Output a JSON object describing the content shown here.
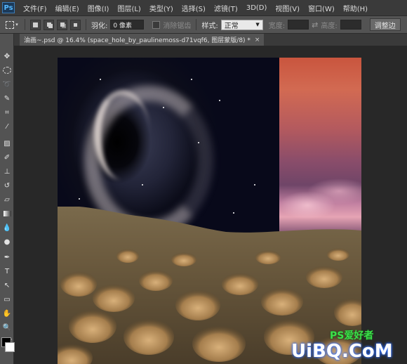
{
  "menubar": {
    "logo": "Ps",
    "items": [
      "文件(F)",
      "编辑(E)",
      "图像(I)",
      "图层(L)",
      "类型(Y)",
      "选择(S)",
      "滤镜(T)",
      "3D(D)",
      "视图(V)",
      "窗口(W)",
      "帮助(H)"
    ]
  },
  "options": {
    "feather_label": "羽化:",
    "feather_value": "0 像素",
    "antialias_label": "消除锯齿",
    "style_label": "样式:",
    "style_value": "正常",
    "width_label": "宽度:",
    "height_label": "高度:",
    "adjust_edge_button": "调整边"
  },
  "document": {
    "tab_title": "油画~.psd @ 16.4% (space_hole_by_paulinemoss-d71vqf6, 图层蒙版/8) *",
    "close_glyph": "×"
  },
  "watermark": {
    "site": "UiBQ.CoM",
    "ps_text": "PS爱好者"
  },
  "colors": {
    "app_bg": "#282828",
    "panel": "#535353",
    "menubar": "#3a3a3a"
  },
  "tools": [
    "move-icon",
    "marquee-icon",
    "lasso-icon",
    "quick-select-icon",
    "crop-icon",
    "eyedropper-icon",
    "healing-icon",
    "brush-icon",
    "stamp-icon",
    "history-brush-icon",
    "eraser-icon",
    "gradient-icon",
    "blur-icon",
    "dodge-icon",
    "pen-icon",
    "type-icon",
    "path-select-icon",
    "shape-icon",
    "hand-icon",
    "zoom-icon"
  ]
}
